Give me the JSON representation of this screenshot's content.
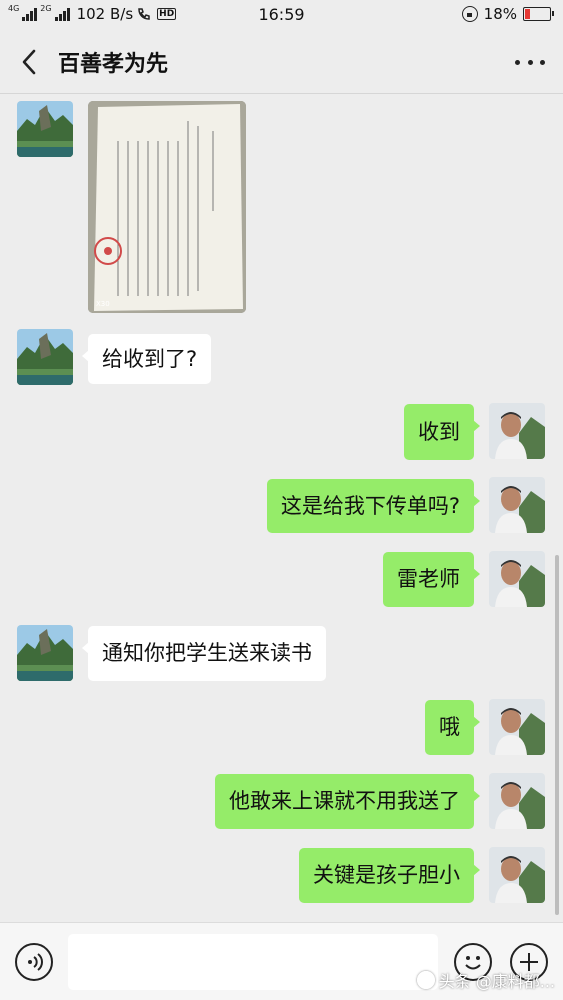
{
  "status_bar": {
    "net_tag_1": "4G",
    "net_tag_2": "2G",
    "speed": "102 B/s",
    "hd_label": "HD",
    "time": "16:59",
    "battery": "18%",
    "battery_level": 0.18
  },
  "header": {
    "title": "百善孝为先"
  },
  "messages": [
    {
      "side": "left",
      "type": "image"
    },
    {
      "side": "left",
      "type": "text",
      "text": "给收到了?"
    },
    {
      "side": "right",
      "type": "text",
      "text": "收到"
    },
    {
      "side": "right",
      "type": "text",
      "text": "这是给我下传单吗?"
    },
    {
      "side": "right",
      "type": "text",
      "text": "雷老师"
    },
    {
      "side": "left",
      "type": "text",
      "text": "通知你把学生送来读书"
    },
    {
      "side": "right",
      "type": "text",
      "text": "哦"
    },
    {
      "side": "right",
      "type": "text",
      "text": "他敢来上课就不用我送了"
    },
    {
      "side": "right",
      "type": "text",
      "text": "关键是孩子胆小"
    }
  ],
  "input_bar": {
    "placeholder": ""
  },
  "watermark": {
    "text": "头条 @康料都..."
  },
  "colors": {
    "bubble_self": "#95ec69",
    "bubble_other": "#ffffff",
    "background": "#ededed"
  }
}
